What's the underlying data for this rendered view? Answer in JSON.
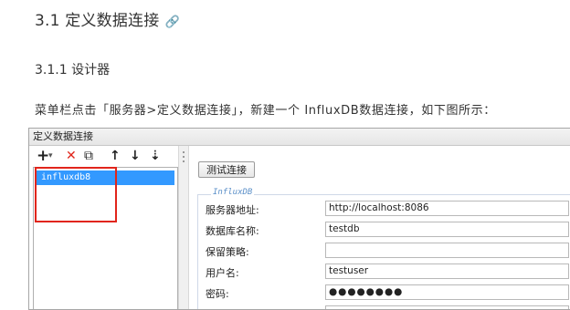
{
  "heading": {
    "title": "3.1 定义数据连接",
    "anchor_icon": "🔗"
  },
  "subheading": {
    "title": "3.1.1 设计器"
  },
  "paragraph": "菜单栏点击「服务器>定义数据连接」，新建一个 InfluxDB数据连接，如下图所示：",
  "dialog": {
    "title": "定义数据连接",
    "toolbar": {
      "add": "+",
      "add_arrow": "▾",
      "delete": "✕",
      "copy": "⧉",
      "up": "↑",
      "down": "↓",
      "sort": "⇣"
    },
    "tree": {
      "items": [
        "influxdb8"
      ]
    },
    "test_button": "测试连接",
    "group_title": "InfluxDB",
    "fields": [
      {
        "label": "服务器地址:",
        "value": "http://localhost:8086"
      },
      {
        "label": "数据库名称:",
        "value": "testdb"
      },
      {
        "label": "保留策略:",
        "value": ""
      },
      {
        "label": "用户名:",
        "value": "testuser"
      },
      {
        "label": "密码:",
        "value": "●●●●●●●●"
      }
    ],
    "colors": {
      "selection": "#3399ff",
      "highlight_box": "#e1251b",
      "group_title": "#5a8fc8"
    }
  }
}
